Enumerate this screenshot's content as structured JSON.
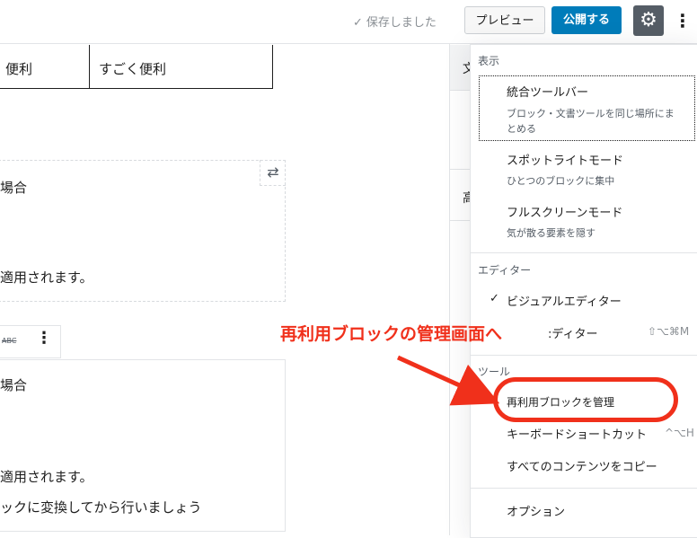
{
  "topbar": {
    "saved_check": "✓",
    "saved_label": "保存しました",
    "preview_label": "プレビュー",
    "publish_label": "公開する",
    "settings_icon": "⚙",
    "more_icon": "⋮"
  },
  "editor": {
    "table": {
      "cell1": "便利",
      "cell2": "すごく便利"
    },
    "block1": {
      "line1": "場合",
      "line2": "適用されます。",
      "swap_icon": "⇄"
    },
    "toolbar": {
      "strike_label": "ABC",
      "more_icon": "⋮"
    },
    "block2": {
      "line1": "場合",
      "line2": "適用されます。",
      "line3": "ックに変換してから行いましょう"
    }
  },
  "sidebar": {
    "tab_label": "文",
    "dots": "⋮",
    "heading_char": "高"
  },
  "menu": {
    "view_title": "表示",
    "view_items": [
      {
        "label": "統合ツールバー",
        "desc_line1": "ブロック・文書ツールを同じ場所にま",
        "desc_line2": "とめる"
      },
      {
        "label": "スポットライトモード",
        "desc_line1": "ひとつのブロックに集中"
      },
      {
        "label": "フルスクリーンモード",
        "desc_line1": "気が散る要素を隠す"
      }
    ],
    "editor_title": "エディター",
    "editor_items": [
      {
        "check": "✓",
        "label": "ビジュアルエディター"
      },
      {
        "label": ":ディター",
        "shortcut": "⇧⌥⌘M"
      }
    ],
    "tools_title": "ツール",
    "tools_items": [
      {
        "label": "再利用ブロックを管理"
      },
      {
        "label": "キーボードショートカット",
        "shortcut": "^⌥H"
      },
      {
        "label": "すべてのコンテンツをコピー"
      }
    ],
    "options_label": "オプション"
  },
  "annotation": {
    "text": "再利用ブロックの管理画面へ",
    "color": "#f0301b"
  },
  "colors": {
    "publish": "#007cba",
    "settings_bg": "#555d66"
  }
}
